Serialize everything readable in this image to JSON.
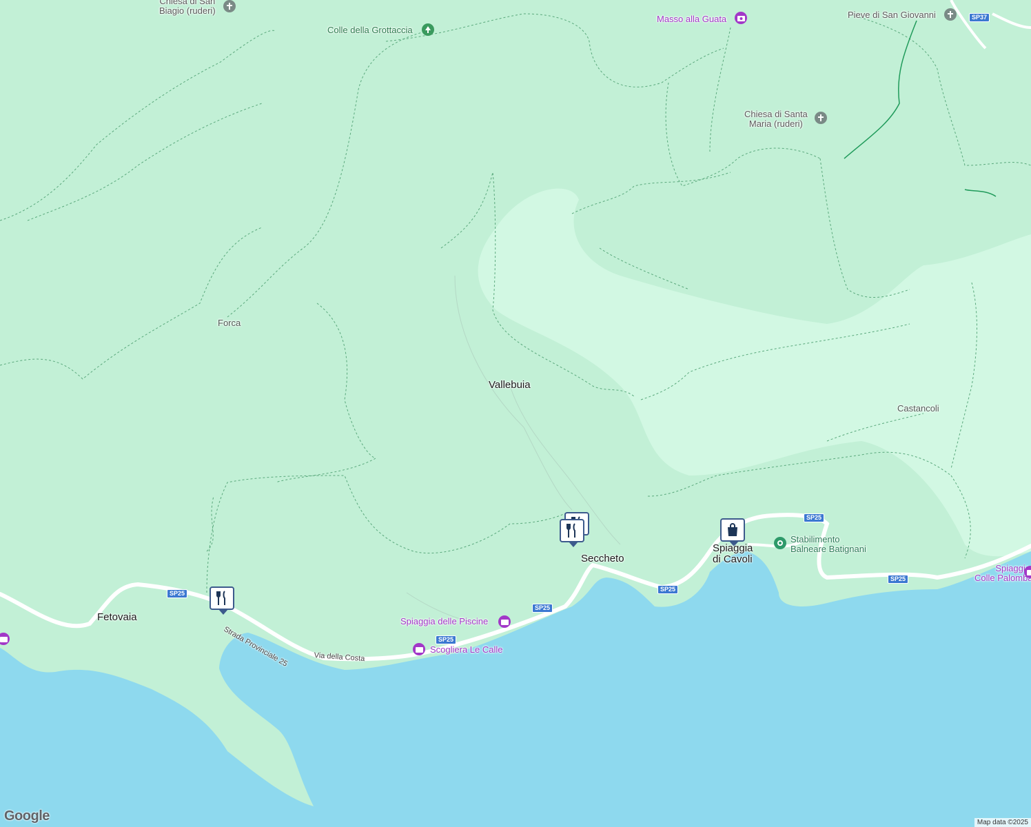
{
  "places": {
    "chiesa_san_biagio": "Chiesa di San\nBiagio (ruderi)",
    "colle_grottaccia": "Colle della Grottaccia",
    "masso_guata": "Masso alla Guata",
    "pieve_san_giovanni": "Pieve di San Giovanni",
    "chiesa_santa_maria": "Chiesa di Santa\nMaria (ruderi)",
    "forca": "Forca",
    "vallebuia": "Vallebuia",
    "castancoli": "Castancoli",
    "seccheto": "Seccheto",
    "spiaggia_cavoli": "Spiaggia\ndi Cavoli",
    "stabilimento": "Stabilimento\nBalneare Batignani",
    "spiaggia_colle_palombaia": "Spiaggia di\nColle Palombaia",
    "fetovaia": "Fetovaia",
    "spiaggia_piscine": "Spiaggia delle Piscine",
    "scogliera_le_calle": "Scogliera Le Calle"
  },
  "roads": {
    "strada_provinciale": "Strada Provinciale 25",
    "via_costa": "Via della Costa",
    "sp25": "SP25",
    "sp37": "SP37"
  },
  "icons": {
    "restaurant": "restaurant-icon",
    "shopping": "shopping-bag-icon",
    "camera": "camera-icon",
    "church": "church-icon",
    "park": "tree-icon",
    "beach": "beach-icon"
  },
  "colors": {
    "land": "#c2f0d6",
    "lowland": "#d2f8e3",
    "sea": "#8ed9ee",
    "road": "#ffffff",
    "trail": "#5aa87c",
    "poi_purple": "#a238c8",
    "pin_border": "#3c5a8c"
  },
  "footer": {
    "logo": "Google",
    "attribution": "Map data ©2025"
  }
}
